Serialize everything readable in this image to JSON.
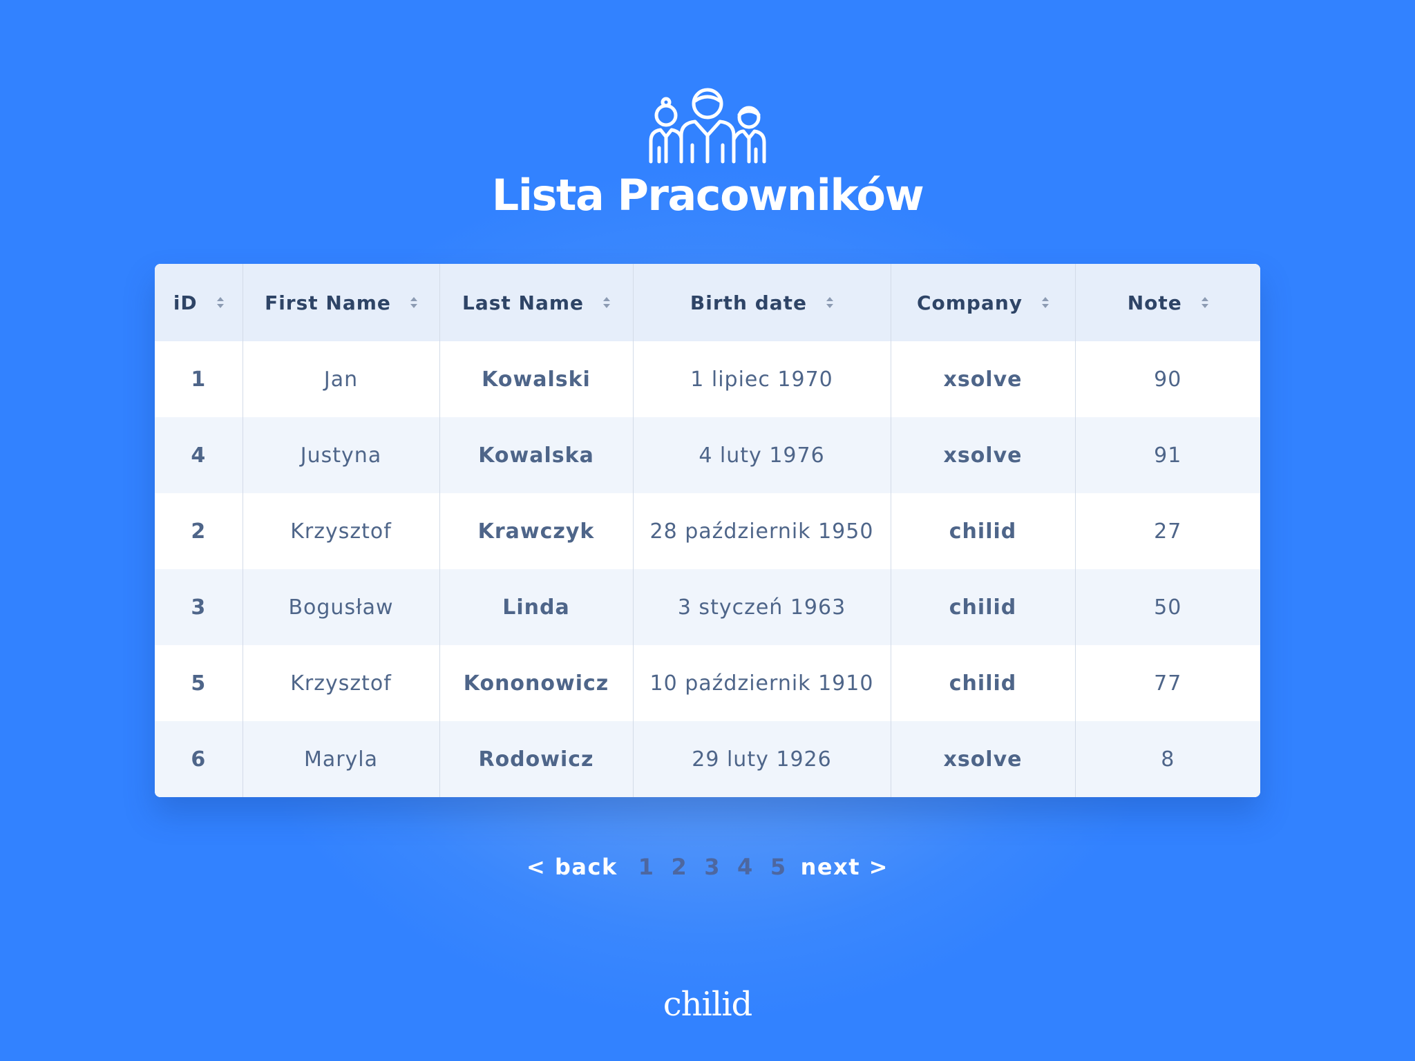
{
  "header": {
    "icon": "team-people-icon",
    "title": "Lista Pracowników"
  },
  "table": {
    "columns": [
      "iD",
      "First Name",
      "Last Name",
      "Birth date",
      "Company",
      "Note"
    ],
    "rows": [
      [
        "1",
        "Jan",
        "Kowalski",
        "1 lipiec 1970",
        "xsolve",
        "90"
      ],
      [
        "4",
        "Justyna",
        "Kowalska",
        "4 luty 1976",
        "xsolve",
        "91"
      ],
      [
        "2",
        "Krzysztof",
        "Krawczyk",
        "28 październik 1950",
        "chilid",
        "27"
      ],
      [
        "3",
        "Bogusław",
        "Linda",
        "3 styczeń 1963",
        "chilid",
        "50"
      ],
      [
        "5",
        "Krzysztof",
        "Kononowicz",
        "10 październik 1910",
        "chilid",
        "77"
      ],
      [
        "6",
        "Maryla",
        "Rodowicz",
        "29 luty 1926",
        "xsolve",
        "8"
      ]
    ]
  },
  "pagination": {
    "back": "< back",
    "pages": [
      "1",
      "2",
      "3",
      "4",
      "5"
    ],
    "next": "next >"
  },
  "footer": {
    "brand": "chilid"
  },
  "colors": {
    "background": "#3282ff",
    "header_row": "#e6eefa",
    "row_alt": "#f0f5fc",
    "cell_text": "#4e6589",
    "header_text": "#2e4466",
    "page_number": "#4d67a0"
  }
}
